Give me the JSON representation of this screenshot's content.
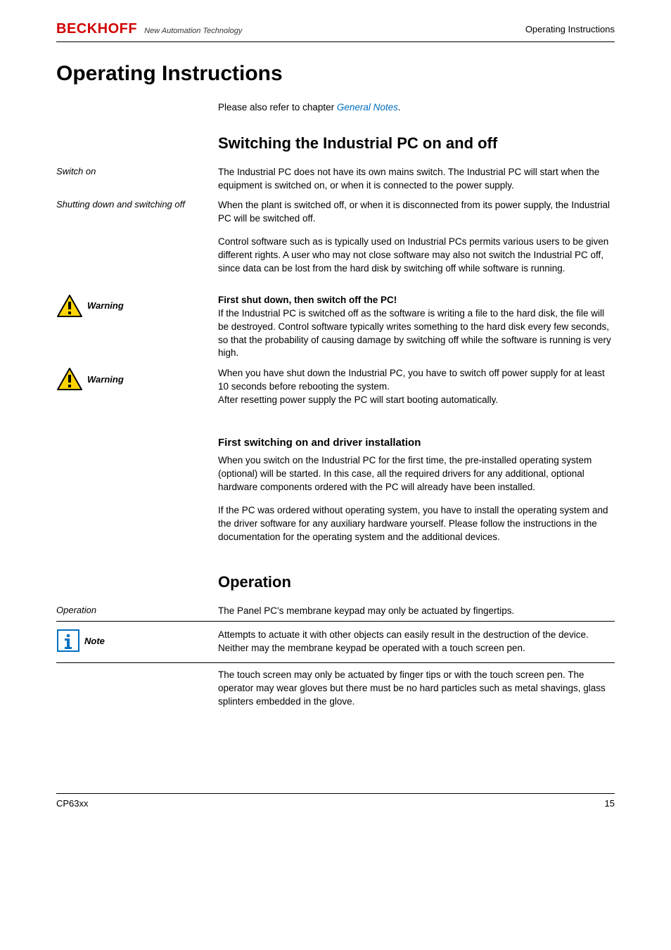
{
  "header": {
    "brand": "BECKHOFF",
    "tagline": "New Automation Technology",
    "section": "Operating Instructions"
  },
  "title": "Operating Instructions",
  "intro": {
    "prefix": "Please also refer to chapter ",
    "link": "General Notes",
    "suffix": "."
  },
  "sections": {
    "switching": {
      "heading": "Switching the Industrial PC on and off",
      "switch_on": {
        "side": "Switch on",
        "body": "The Industrial PC does not have its own mains switch. The Industrial PC will start when the equipment is switched on, or when it is connected to the power supply."
      },
      "shut_off": {
        "side": "Shutting down and switching off",
        "p1": "When the plant is switched off, or when it is disconnected from its power supply, the Industrial PC will be switched off.",
        "p2": "Control software such as is typically used on Industrial PCs permits various users to be given different rights. A user who may not close software may also not switch the Industrial PC off, since data can be lost from the hard disk by switching off while software is running."
      },
      "warning1": {
        "side": "Warning",
        "head": "First shut down, then switch off the PC!",
        "body": "If the Industrial PC is switched off as the software is writing a file to the hard disk, the file will be destroyed. Control software typically writes something to the hard disk every few seconds, so that the probability of causing damage by switching off while the software is running is very high."
      },
      "warning2": {
        "side": "Warning",
        "p1": "When you have shut down the Industrial PC, you have to switch off power supply for at least 10 seconds before rebooting the system.",
        "p2": "After resetting power supply the PC will start booting automatically."
      },
      "first_switch": {
        "heading": "First switching on and driver installation",
        "p1": "When you switch on the Industrial PC for the first time, the pre-installed operating system (optional) will be started. In this case, all the required drivers for any additional, optional hardware components ordered with the PC will already have been installed.",
        "p2": "If the PC was ordered without operating system, you have to install the operating system and the driver software for any auxiliary hardware yourself. Please follow the instructions in the documentation for the operating system and the additional devices."
      }
    },
    "operation": {
      "heading": "Operation",
      "intro": {
        "side": "Operation",
        "body": "The Panel PC's membrane keypad may only be actuated by fingertips."
      },
      "note": {
        "side": "Note",
        "body": "Attempts to actuate it with other objects can easily result in the destruction of the device. Neither may the membrane keypad be operated with a touch screen pen."
      },
      "touch": "The touch screen may only be actuated by finger tips or with the touch screen pen. The operator may wear gloves but there must be no hard particles such as metal shavings, glass splinters embedded in the glove."
    }
  },
  "footer": {
    "left": "CP63xx",
    "right": "15"
  }
}
